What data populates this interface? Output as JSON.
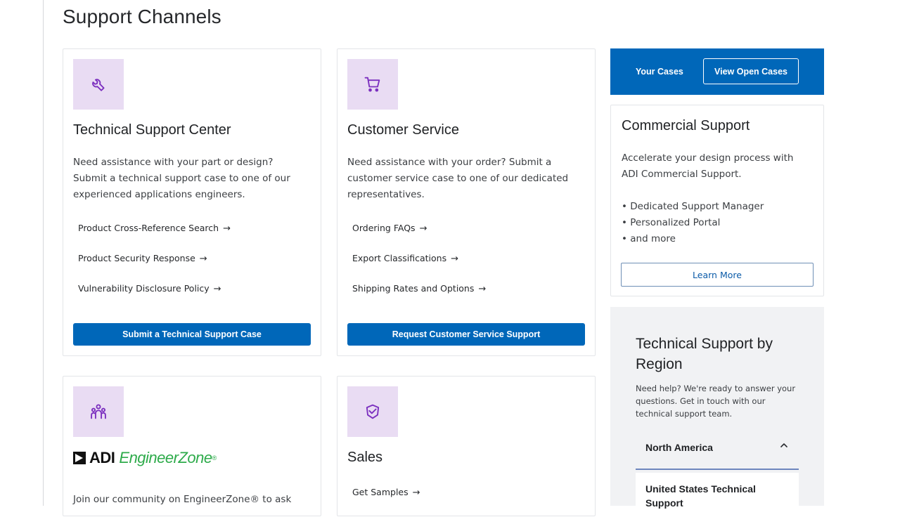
{
  "page": {
    "title": "Support Channels"
  },
  "cards": {
    "technical": {
      "icon": "wrench-icon",
      "title": "Technical Support Center",
      "description": "Need assistance with your part or design? Submit a technical support case to one of our experienced applications engineers.",
      "links": [
        "Product Cross-Reference Search",
        "Product Security Response",
        "Vulnerability Disclosure Policy"
      ],
      "button": "Submit a Technical Support Case"
    },
    "customer": {
      "icon": "cart-icon",
      "title": "Customer Service",
      "description": "Need assistance with your order? Submit a customer service case to one of our dedicated representatives.",
      "links": [
        "Ordering FAQs",
        "Export Classifications",
        "Shipping Rates and Options"
      ],
      "button": "Request Customer Service Support"
    },
    "engineerzone": {
      "icon": "community-icon",
      "logo_text_adi": "ADI",
      "logo_text_ez": "EngineerZone",
      "logo_reg": "®",
      "description": "Join our community on EngineerZone® to ask"
    },
    "sales": {
      "icon": "handshake-icon",
      "title": "Sales",
      "links": [
        "Get Samples"
      ]
    }
  },
  "arrow": "→",
  "your_cases": {
    "label": "Your Cases",
    "button": "View Open Cases"
  },
  "commercial": {
    "title": "Commercial Support",
    "description": "Accelerate your design process with ADI Commercial Support.",
    "bullets": [
      "• Dedicated Support Manager",
      "• Personalized Portal",
      "• and more"
    ],
    "button": "Learn More"
  },
  "region": {
    "title": "Technical Support by Region",
    "description": "Need help? We're ready to answer your questions. Get in touch with our technical support team.",
    "selected": "North America",
    "chevron": "^",
    "sub_title": "United States Technical Support"
  },
  "colors": {
    "brand_blue": "#0067b9",
    "icon_bg": "#e9dcf3",
    "icon_purple": "#7b2fbf"
  }
}
